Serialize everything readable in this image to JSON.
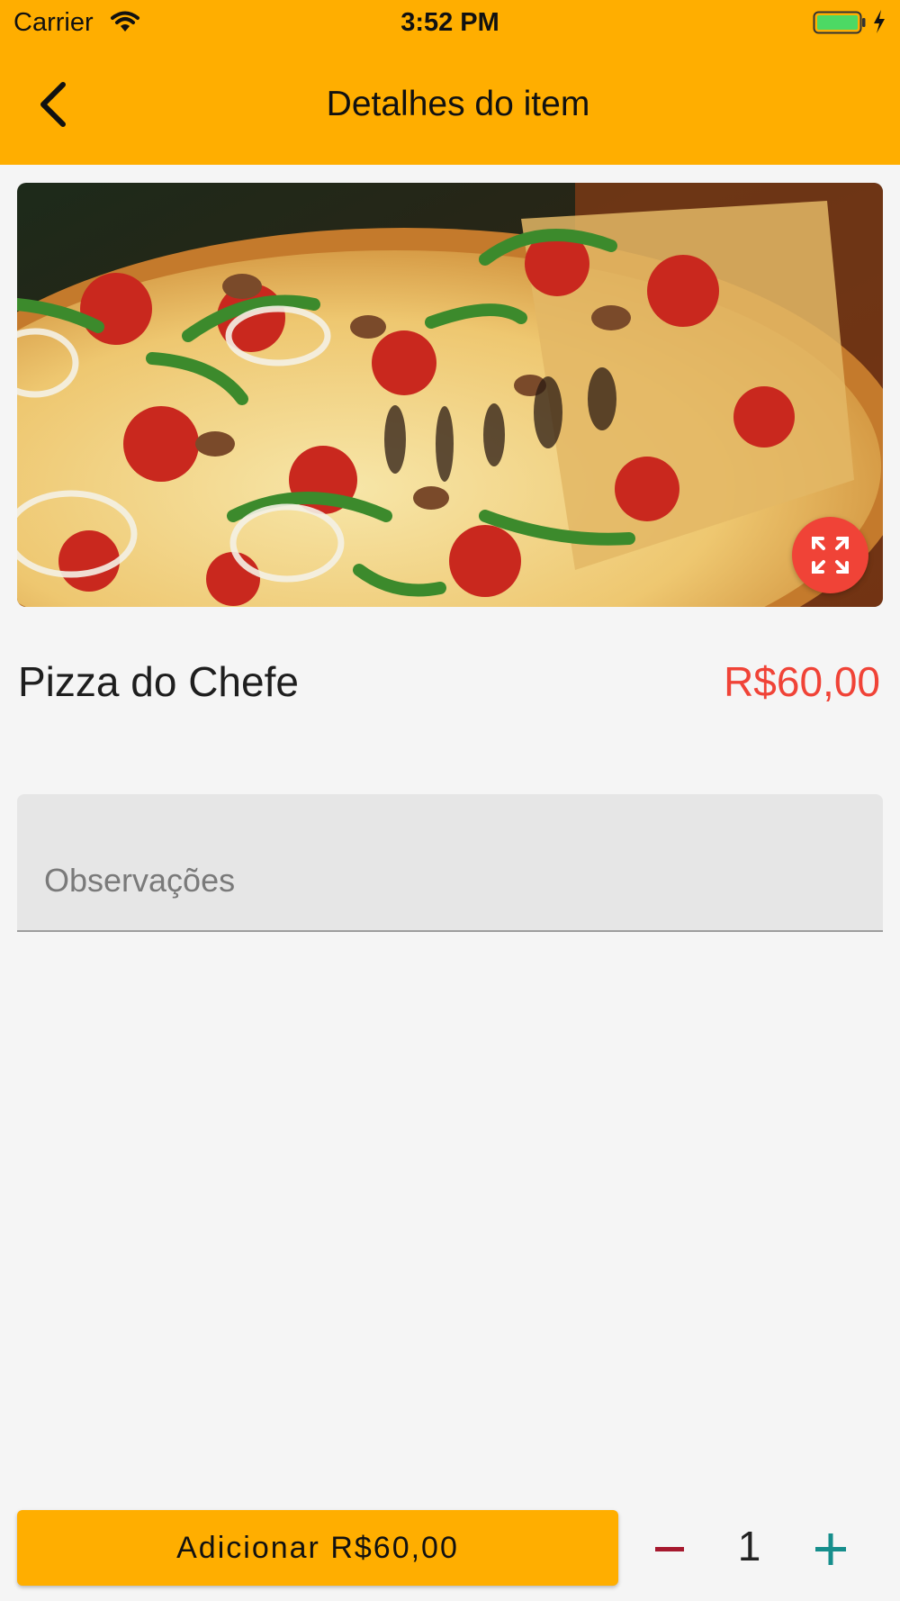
{
  "status_bar": {
    "carrier": "Carrier",
    "time": "3:52 PM",
    "battery_icon": "battery-icon",
    "wifi_icon": "wifi-icon"
  },
  "header": {
    "title": "Detalhes do item",
    "back_icon": "chevron-left-icon",
    "background_color": "#FFAE00"
  },
  "item": {
    "image_icon": "pizza-photo",
    "expand_icon": "expand-arrows-icon",
    "name": "Pizza do Chefe",
    "price": "R$60,00",
    "price_color": "#F04337"
  },
  "notes": {
    "placeholder": "Observações",
    "value": ""
  },
  "footer": {
    "add_button_label": "Adicionar R$60,00",
    "quantity": "1",
    "minus_icon": "minus-icon",
    "plus_icon": "plus-icon",
    "minus_color": "#A6192E",
    "plus_color": "#168E8C"
  }
}
